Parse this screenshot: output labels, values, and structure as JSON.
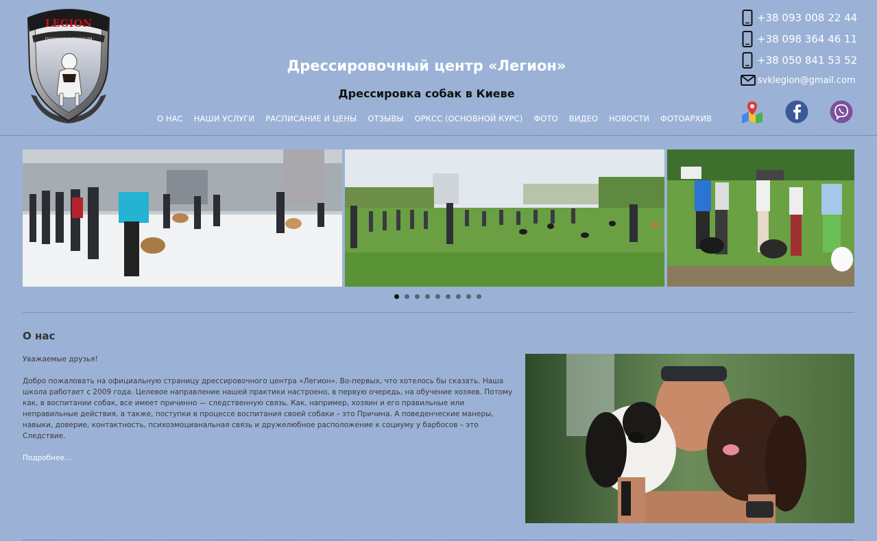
{
  "header": {
    "title": "Дрессировочный центр «Легион»",
    "subtitle": "Дрессировка собак в Киеве",
    "logo_text_top": "LEGION",
    "logo_text_band": "DOMINUS NOBISCUM"
  },
  "nav": [
    "О НАС",
    "НАШИ УСЛУГИ",
    "РАСПИСАНИЕ И ЦЕНЫ",
    "ОТЗЫВЫ",
    "ОРКСС (ОСНОВНОЙ КУРС)",
    "ФОТО",
    "ВИДЕО",
    "НОВОСТИ",
    "ФОТОАРХИВ"
  ],
  "contacts": {
    "phones": [
      "+38 093 008 22 44",
      "+38 098 364 46 11",
      "+38 050 841 53 52"
    ],
    "email": "svklegion@gmail.com"
  },
  "social": [
    "map-pin-icon",
    "facebook-icon",
    "viber-icon"
  ],
  "slider": {
    "slides": [
      "snow-training",
      "field-group",
      "park-handlers"
    ],
    "dot_count": 9,
    "active_dot": 0
  },
  "about": {
    "title": "О нас",
    "greeting": "Уважаемые друзья!",
    "body": "Добро пожаловать на официальную страницу дрессировочного центра «Легион». Во-первых, что хотелось бы сказать. Наша школа работает с 2009 года. Целевое направление нашей практики настроено, в первую очередь, на обучение хозяев. Потому как, в воспитании собак, все имеет причинно — следственную связь. Как, например, хозяин и его правильные или неправильные действия, а также, поступки в процессе воспитания своей собаки – это Причина. А поведенческие манеры, навыки, доверие, контактность, психоэмоцианальная связь и дружелюбное расположение к социуму у барбосов – это Следствие.",
    "more_link": "Подробнее..."
  },
  "colors": {
    "background": "#9bb2d6",
    "accent_white": "#ffffff",
    "logo_red": "#c0141a"
  }
}
